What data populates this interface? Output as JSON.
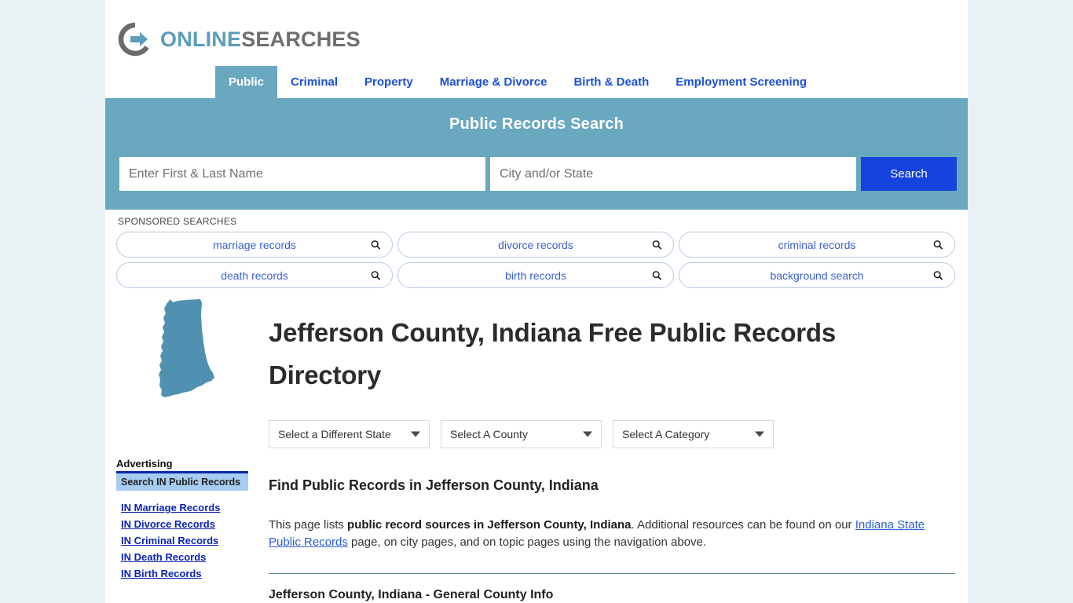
{
  "logo": {
    "icon": "circle-arrow-logo-icon",
    "word1": "ONLINE",
    "word2": "SEARCHES"
  },
  "nav": {
    "tabs": [
      {
        "label": "Public",
        "active": true
      },
      {
        "label": "Criminal",
        "active": false
      },
      {
        "label": "Property",
        "active": false
      },
      {
        "label": "Marriage & Divorce",
        "active": false
      },
      {
        "label": "Birth & Death",
        "active": false
      },
      {
        "label": "Employment Screening",
        "active": false
      }
    ]
  },
  "banner": {
    "title": "Public Records Search",
    "name_placeholder": "Enter First & Last Name",
    "name_value": "",
    "place_placeholder": "City and/or State",
    "place_value": "",
    "search_label": "Search",
    "bg_color": "#6aa8c0",
    "button_color": "#1543dd"
  },
  "sponsored": {
    "label": "SPONSORED SEARCHES",
    "items": [
      "marriage records",
      "divorce records",
      "criminal records",
      "death records",
      "birth records",
      "background search"
    ]
  },
  "sidebar": {
    "map_alt": "indiana-state-map-icon",
    "map_color": "#5090b0",
    "ad_title": "Advertising",
    "ad_header": "Search IN Public Records",
    "links": [
      "IN Marriage Records",
      "IN Divorce Records",
      "IN Criminal Records",
      "IN Death Records",
      "IN Birth Records"
    ]
  },
  "main": {
    "title": "Jefferson County, Indiana Free Public Records Directory",
    "selects": [
      {
        "name": "state",
        "value": "Select a Different State"
      },
      {
        "name": "county",
        "value": "Select A County"
      },
      {
        "name": "category",
        "value": "Select A Category"
      }
    ],
    "section_title": "Find Public Records in Jefferson County, Indiana",
    "intro": {
      "part1": "This page lists ",
      "bold1": "public record sources in Jefferson County, Indiana",
      "part2": ". Additional resources can be found on our ",
      "link": "Indiana State Public Records",
      "part3": " page, on city pages, and on topic pages using the navigation above."
    },
    "sub_title": "Jefferson County, Indiana - General County Info"
  }
}
